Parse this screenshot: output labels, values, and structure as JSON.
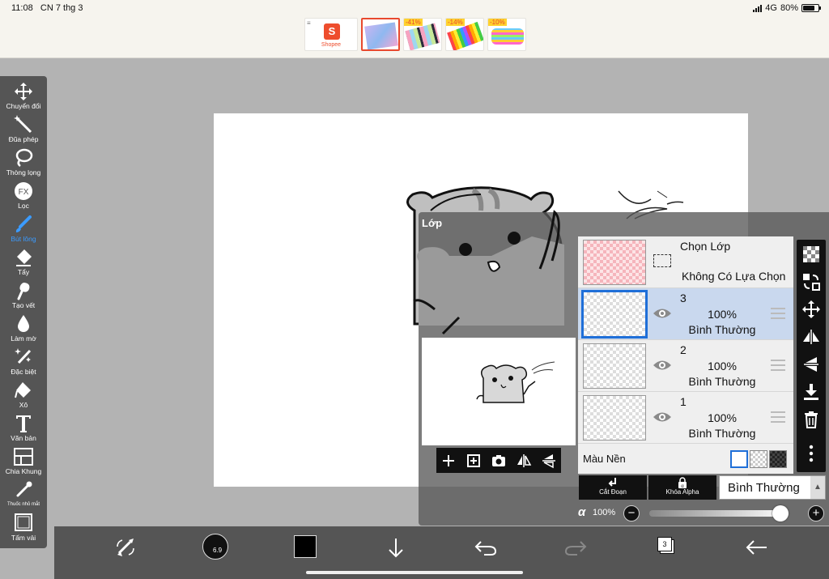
{
  "status_bar": {
    "time": "11:08",
    "date": "CN 7 thg 3",
    "network": "4G",
    "battery": "80%",
    "battery_level": 0.8
  },
  "ad_strip": {
    "logo_text": "Shopee",
    "badges": [
      "-41%",
      "-14%",
      "-10%"
    ]
  },
  "tools": [
    {
      "label": "Chuyển đổi",
      "icon": "move-icon"
    },
    {
      "label": "Đũa phép",
      "icon": "magic-wand-icon"
    },
    {
      "label": "Thòng lọng",
      "icon": "lasso-icon"
    },
    {
      "label": "Lọc",
      "icon": "fx-filter-icon"
    },
    {
      "label": "Bút lông",
      "icon": "brush-icon",
      "active": true
    },
    {
      "label": "Tẩy",
      "icon": "eraser-icon"
    },
    {
      "label": "Tạo vết",
      "icon": "smudge-icon"
    },
    {
      "label": "Làm mờ",
      "icon": "blur-icon"
    },
    {
      "label": "Đặc biệt",
      "icon": "special-brush-icon"
    },
    {
      "label": "Xô",
      "icon": "bucket-icon"
    },
    {
      "label": "Văn bản",
      "icon": "text-icon"
    },
    {
      "label": "Chia Khung",
      "icon": "frame-divider-icon"
    },
    {
      "label": "Thuốc nhỏ mắt",
      "icon": "eyedropper-icon"
    },
    {
      "label": "Tấm vải",
      "icon": "canvas-icon"
    }
  ],
  "layer_panel": {
    "title": "Lớp",
    "selection_layer": {
      "title": "Chọn Lớp",
      "subtitle": "Không Có Lựa Chọn"
    },
    "layers": [
      {
        "number": "3",
        "opacity": "100%",
        "blend": "Bình Thường",
        "selected": true
      },
      {
        "number": "2",
        "opacity": "100%",
        "blend": "Bình Thường",
        "selected": false
      },
      {
        "number": "1",
        "opacity": "100%",
        "blend": "Bình Thường",
        "selected": false
      }
    ],
    "background_label": "Màu Nền",
    "clip_label": "Cắt Đoạn",
    "alpha_lock_label": "Khóa Alpha",
    "blend_mode": "Bình Thường",
    "alpha_symbol": "α",
    "alpha_value": "100%",
    "alpha_level": 1.0
  },
  "bottom_bar": {
    "brush_size": "6.9",
    "layer_count": "3",
    "brush_color": "#000000"
  },
  "colors": {
    "accent": "#3b9bff",
    "selected_row": "#c9d8ee",
    "selected_border": "#1f6fd8",
    "toolbar": "#555555"
  }
}
